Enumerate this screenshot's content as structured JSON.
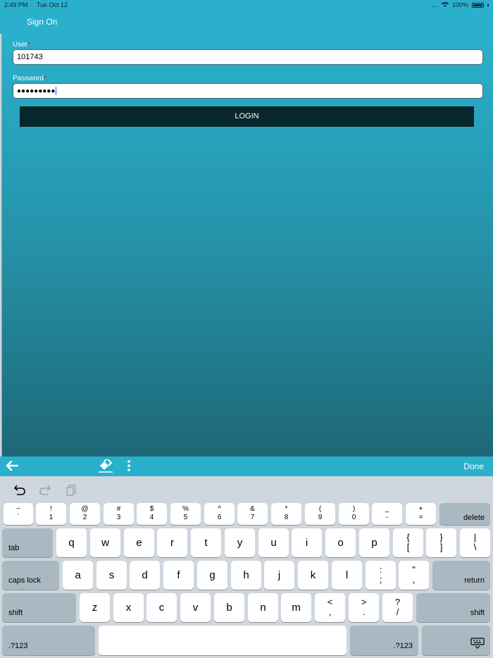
{
  "status_bar": {
    "time": "2:49 PM",
    "date": "Tue Oct 12",
    "battery": "100%"
  },
  "nav": {
    "title": "Sign On"
  },
  "form": {
    "user_label": "User",
    "user_value": "101743",
    "password_label": "Password",
    "password_masked": "●●●●●●●●●",
    "required_mark": "*",
    "login_label": "LOGIN"
  },
  "accessory": {
    "done_label": "Done"
  },
  "keyboard": {
    "row1": [
      {
        "top": "~",
        "bottom": "`"
      },
      {
        "top": "!",
        "bottom": "1"
      },
      {
        "top": "@",
        "bottom": "2"
      },
      {
        "top": "#",
        "bottom": "3"
      },
      {
        "top": "$",
        "bottom": "4"
      },
      {
        "top": "%",
        "bottom": "5"
      },
      {
        "top": "^",
        "bottom": "6"
      },
      {
        "top": "&",
        "bottom": "7"
      },
      {
        "top": "*",
        "bottom": "8"
      },
      {
        "top": "(",
        "bottom": "9"
      },
      {
        "top": ")",
        "bottom": "0"
      },
      {
        "top": "_",
        "bottom": "-"
      },
      {
        "top": "+",
        "bottom": "="
      }
    ],
    "delete": "delete",
    "tab": "tab",
    "row2": [
      "q",
      "w",
      "e",
      "r",
      "t",
      "y",
      "u",
      "i",
      "o",
      "p"
    ],
    "row2_sym": [
      {
        "top": "{",
        "bottom": "["
      },
      {
        "top": "}",
        "bottom": "]"
      },
      {
        "top": "|",
        "bottom": "\\"
      }
    ],
    "caps_lock": "caps lock",
    "row3": [
      "a",
      "s",
      "d",
      "f",
      "g",
      "h",
      "j",
      "k",
      "l"
    ],
    "row3_sym": [
      {
        "top": ":",
        "bottom": ";"
      },
      {
        "top": "\"",
        "bottom": ","
      }
    ],
    "return": "return",
    "shift": "shift",
    "row4": [
      "z",
      "x",
      "c",
      "v",
      "b",
      "n",
      "m"
    ],
    "row4_sym": [
      {
        "top": "<",
        "bottom": ","
      },
      {
        "top": ">",
        "bottom": "."
      },
      {
        "top": "?",
        "bottom": "/"
      }
    ],
    "numbers": ".?123"
  }
}
